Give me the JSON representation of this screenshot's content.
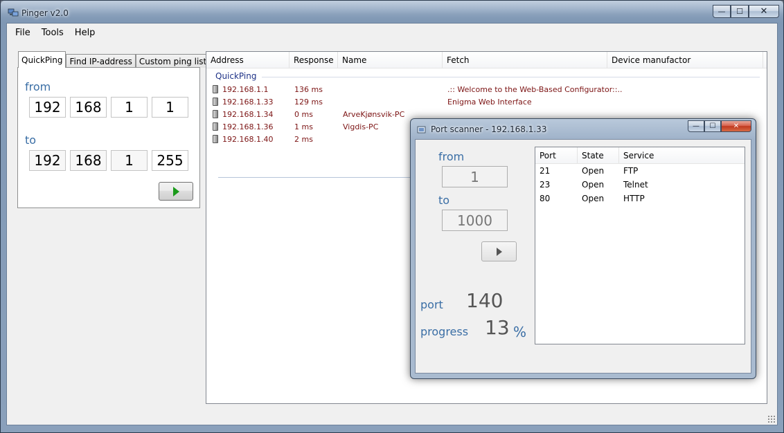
{
  "app": {
    "title": "Pinger v2.0",
    "caption_minimize": "—",
    "caption_maximize": "☐",
    "caption_close": "✕"
  },
  "menu": [
    "File",
    "Tools",
    "Help"
  ],
  "tabs": [
    "QuickPing",
    "Find IP-address",
    "Custom ping list"
  ],
  "quickping": {
    "from_label": "from",
    "to_label": "to",
    "from_ip": [
      "192",
      "168",
      "1",
      "1"
    ],
    "to_ip": [
      "192",
      "168",
      "1",
      "255"
    ],
    "start_icon": "play-icon"
  },
  "results": {
    "columns": [
      "Address",
      "Response",
      "Name",
      "Fetch",
      "Device manufactor"
    ],
    "group_title": "QuickPing",
    "text_color": "#7c1414",
    "rows": [
      {
        "address": "192.168.1.1",
        "response": "136 ms",
        "name": "",
        "fetch": ".:: Welcome to the Web-Based Configurator::..",
        "manufacturer": ""
      },
      {
        "address": "192.168.1.33",
        "response": "129 ms",
        "name": "",
        "fetch": "Enigma Web Interface",
        "manufacturer": ""
      },
      {
        "address": "192.168.1.34",
        "response": "0 ms",
        "name": "ArveKjønsvik-PC",
        "fetch": "",
        "manufacturer": ""
      },
      {
        "address": "192.168.1.36",
        "response": "1 ms",
        "name": "Vigdis-PC",
        "fetch": "",
        "manufacturer": ""
      },
      {
        "address": "192.168.1.40",
        "response": "2 ms",
        "name": "",
        "fetch": "",
        "manufacturer": ""
      }
    ]
  },
  "port_scanner": {
    "title": "Port scanner - 192.168.1.33",
    "from_label": "from",
    "to_label": "to",
    "from_value": "1",
    "to_value": "1000",
    "port_label": "port",
    "port_value": "140",
    "progress_label": "progress",
    "progress_value": "13",
    "progress_unit": "%",
    "caption_minimize": "—",
    "caption_maximize": "☐",
    "caption_close": "✕",
    "columns": [
      "Port",
      "State",
      "Service"
    ],
    "rows": [
      {
        "port": "21",
        "state": "Open",
        "service": "FTP"
      },
      {
        "port": "23",
        "state": "Open",
        "service": "Telnet"
      },
      {
        "port": "80",
        "state": "Open",
        "service": "HTTP"
      }
    ],
    "accent_color": "#3a6ea5"
  }
}
